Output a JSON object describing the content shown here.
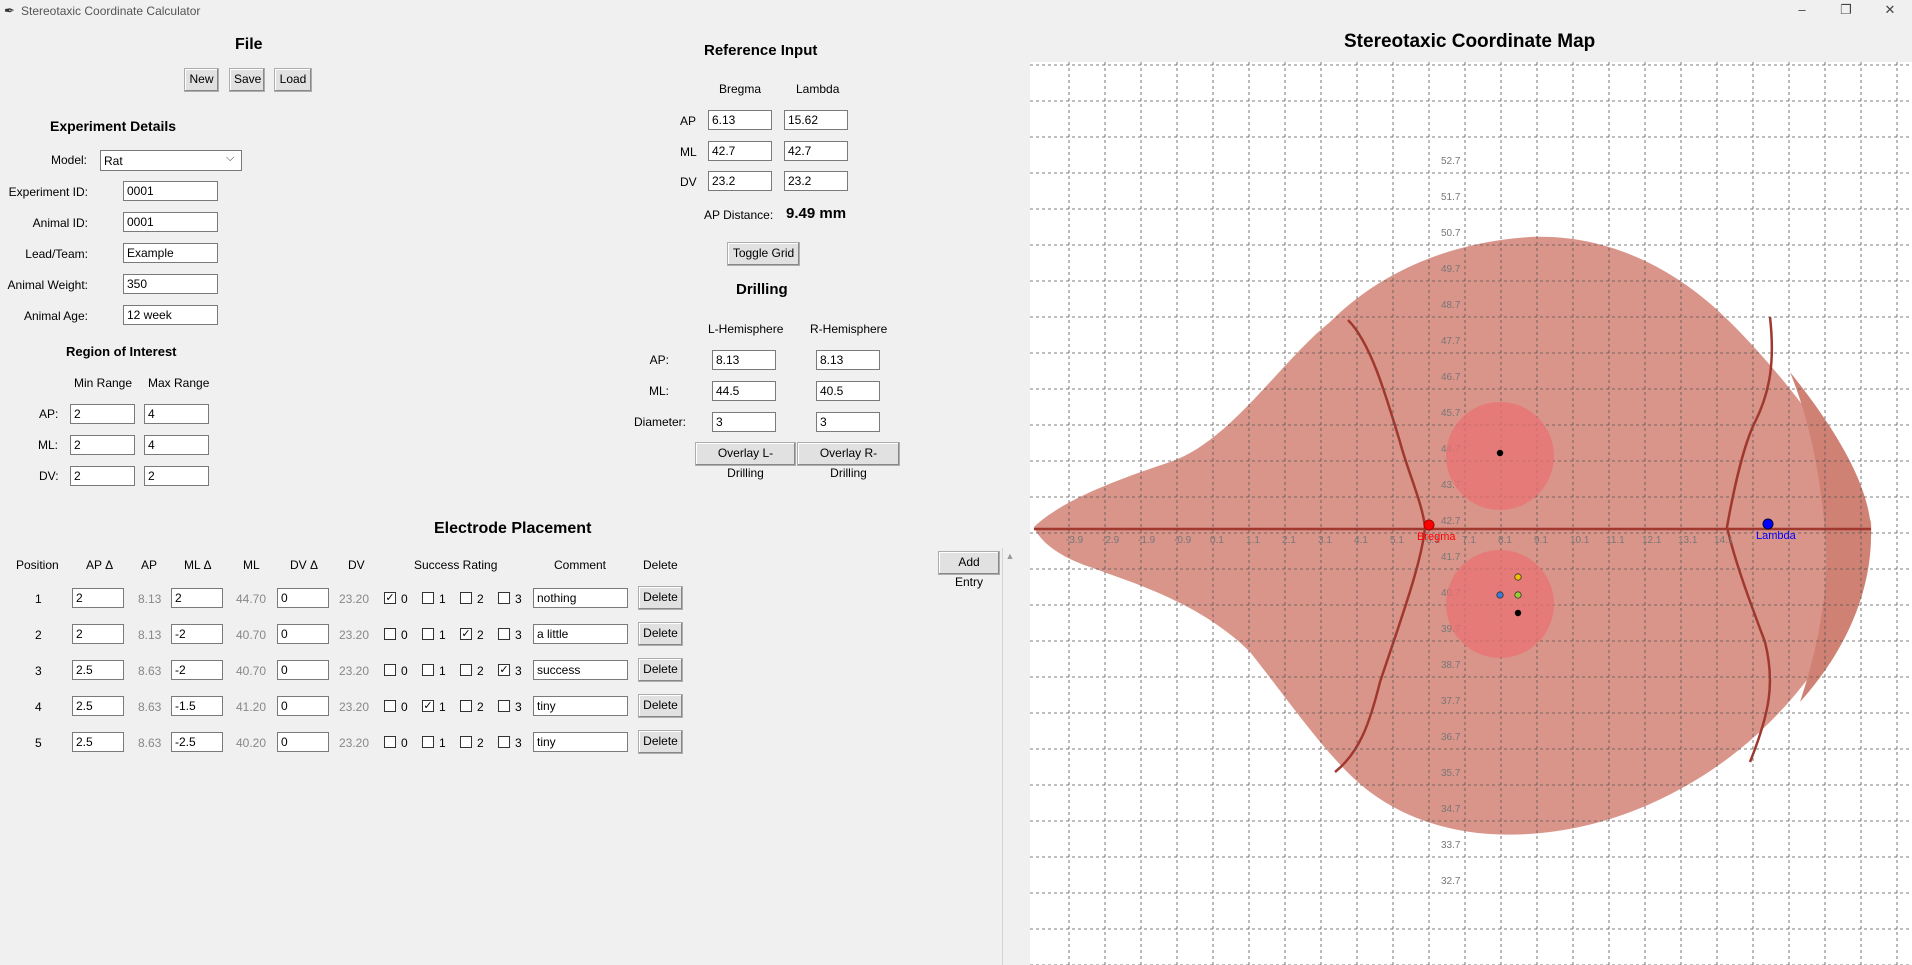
{
  "window": {
    "title": "Stereotaxic Coordinate Calculator",
    "app_icon": "feather-icon",
    "controls": [
      "minimize-icon",
      "restore-icon",
      "close-icon"
    ]
  },
  "file": {
    "heading": "File",
    "buttons": [
      "New",
      "Save",
      "Load"
    ]
  },
  "experiment": {
    "heading": "Experiment Details",
    "model_label": "Model:",
    "model_value": "Rat",
    "fields": [
      {
        "label": "Experiment ID:",
        "value": "0001"
      },
      {
        "label": "Animal ID:",
        "value": "0001"
      },
      {
        "label": "Lead/Team:",
        "value": "Example"
      },
      {
        "label": "Animal Weight:",
        "value": "350"
      },
      {
        "label": "Animal Age:",
        "value": "12 week"
      }
    ]
  },
  "roi": {
    "heading": "Region of Interest",
    "col_min": "Min Range",
    "col_max": "Max Range",
    "rows": [
      {
        "label": "AP:",
        "min": "2",
        "max": "4"
      },
      {
        "label": "ML:",
        "min": "2",
        "max": "4"
      },
      {
        "label": "DV:",
        "min": "2",
        "max": "2"
      }
    ]
  },
  "reference": {
    "heading": "Reference Input",
    "col_bregma": "Bregma",
    "col_lambda": "Lambda",
    "rows": [
      {
        "label": "AP",
        "bregma": "6.13",
        "lambda": "15.62"
      },
      {
        "label": "ML",
        "bregma": "42.7",
        "lambda": "42.7"
      },
      {
        "label": "DV",
        "bregma": "23.2",
        "lambda": "23.2"
      }
    ],
    "ap_distance_label": "AP Distance:",
    "ap_distance_value": "9.49 mm",
    "toggle_grid": "Toggle Grid"
  },
  "drilling": {
    "heading": "Drilling",
    "col_left": "L-Hemisphere",
    "col_right": "R-Hemisphere",
    "rows": [
      {
        "label": "AP:",
        "left": "8.13",
        "right": "8.13"
      },
      {
        "label": "ML:",
        "left": "44.5",
        "right": "40.5"
      },
      {
        "label": "Diameter:",
        "left": "3",
        "right": "3"
      }
    ],
    "overlay_left": "Overlay L-Drilling",
    "overlay_right": "Overlay R-Drilling"
  },
  "electrodes": {
    "heading": "Electrode Placement",
    "add_entry": "Add Entry",
    "columns": [
      "Position",
      "AP Δ",
      "AP",
      "ML Δ",
      "ML",
      "DV Δ",
      "DV",
      "Success Rating",
      "Comment",
      "Delete"
    ],
    "rating_labels": [
      "0",
      "1",
      "2",
      "3"
    ],
    "delete_label": "Delete",
    "rows": [
      {
        "pos": "1",
        "ap_d": "2",
        "ap": "8.13",
        "ml_d": "2",
        "ml": "44.70",
        "dv_d": "0",
        "dv": "23.20",
        "rating": 0,
        "comment": "nothing"
      },
      {
        "pos": "2",
        "ap_d": "2",
        "ap": "8.13",
        "ml_d": "-2",
        "ml": "40.70",
        "dv_d": "0",
        "dv": "23.20",
        "rating": 2,
        "comment": "a little"
      },
      {
        "pos": "3",
        "ap_d": "2.5",
        "ap": "8.63",
        "ml_d": "-2",
        "ml": "40.70",
        "dv_d": "0",
        "dv": "23.20",
        "rating": 3,
        "comment": "success"
      },
      {
        "pos": "4",
        "ap_d": "2.5",
        "ap": "8.63",
        "ml_d": "-1.5",
        "ml": "41.20",
        "dv_d": "0",
        "dv": "23.20",
        "rating": 1,
        "comment": "tiny"
      },
      {
        "pos": "5",
        "ap_d": "2.5",
        "ap": "8.63",
        "ml_d": "-2.5",
        "ml": "40.20",
        "dv_d": "0",
        "dv": "23.20",
        "rating": -1,
        "comment": "tiny"
      }
    ]
  },
  "map": {
    "heading": "Stereotaxic Coordinate Map",
    "x_ticks": [
      "-3.9",
      "-2.9",
      "-1.9",
      "-0.9",
      "0.1",
      "1.1",
      "2.1",
      "3.1",
      "4.1",
      "5.1",
      "6.1",
      "7.1",
      "8.1",
      "9.1",
      "10.1",
      "11.1",
      "12.1",
      "13.1",
      "14.1"
    ],
    "y_ticks": [
      "52.7",
      "51.7",
      "50.7",
      "49.7",
      "48.7",
      "47.7",
      "46.7",
      "45.7",
      "44.7",
      "43.7",
      "42.7",
      "41.7",
      "40.7",
      "39.7",
      "38.7",
      "37.7",
      "36.7",
      "35.7",
      "34.7",
      "33.7",
      "32.7"
    ],
    "bregma_label": "Bregma",
    "lambda_label": "Lambda",
    "colors": {
      "brain": "#d9958a",
      "brain_dark": "#cf8174",
      "suture": "#a0382e",
      "drill": "#e87272",
      "bregma": "#ff0000",
      "lambda": "#0000ff",
      "grid": "#555555"
    }
  }
}
